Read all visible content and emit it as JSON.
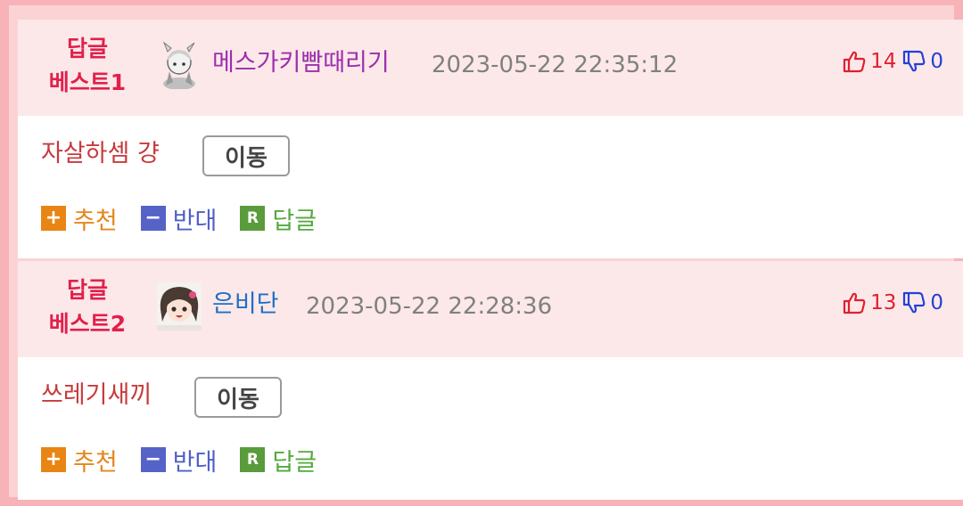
{
  "comments": [
    {
      "rank_line1": "답글",
      "rank_line2": "베스트1",
      "nickname": "메스가키빰때리기",
      "nickname_color": "#9b2fae",
      "datetime": "2023-05-22 22:35:12",
      "up_count": "14",
      "down_count": "0",
      "content": "자살하셈 걍",
      "move_label": "이동",
      "actions": {
        "recommend": "추천",
        "oppose": "반대",
        "reply": "답글"
      }
    },
    {
      "rank_line1": "답글",
      "rank_line2": "베스트2",
      "nickname": "은비단",
      "nickname_color": "#1e6fc8",
      "datetime": "2023-05-22 22:28:36",
      "up_count": "13",
      "down_count": "0",
      "content": "쓰레기새끼",
      "move_label": "이동",
      "actions": {
        "recommend": "추천",
        "oppose": "반대",
        "reply": "답글"
      }
    }
  ],
  "icons": {
    "recommend_box": "+",
    "oppose_box": "−",
    "reply_box": "R"
  }
}
